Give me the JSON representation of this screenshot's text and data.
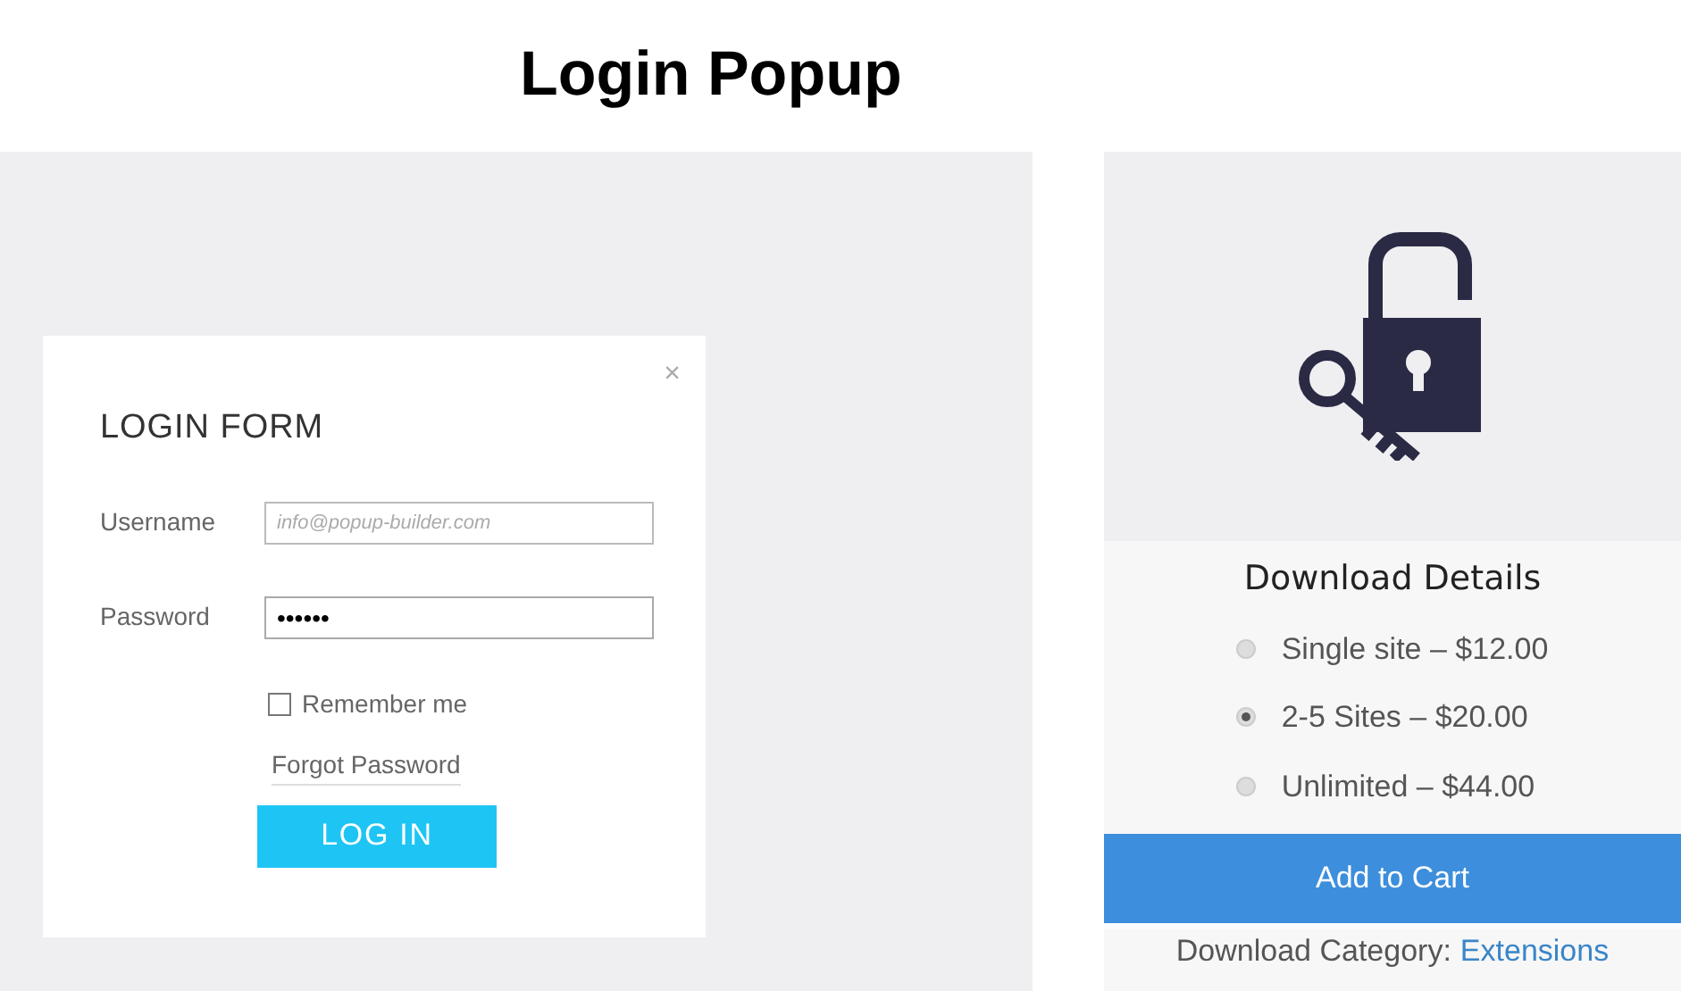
{
  "page_title": "Login Popup",
  "login_form": {
    "title": "LOGIN FORM",
    "close": "×",
    "fields": [
      {
        "label": "Username",
        "placeholder": "info@popup-builder.com",
        "kind": "text"
      },
      {
        "label": "Password",
        "value": "••••••",
        "kind": "password"
      }
    ],
    "remember": {
      "label": "Remember me",
      "checked": false
    },
    "forgot_link": "Forgot Password",
    "submit": "LOG IN"
  },
  "download": {
    "title": "Download Details",
    "options": [
      {
        "label": "Single site – $12.00",
        "selected": false
      },
      {
        "label": "2-5 Sites – $20.00",
        "selected": true
      },
      {
        "label": "Unlimited – $44.00",
        "selected": false
      }
    ],
    "add_to_cart": "Add to Cart",
    "category_label": "Download Category:",
    "category_link": "Extensions"
  }
}
